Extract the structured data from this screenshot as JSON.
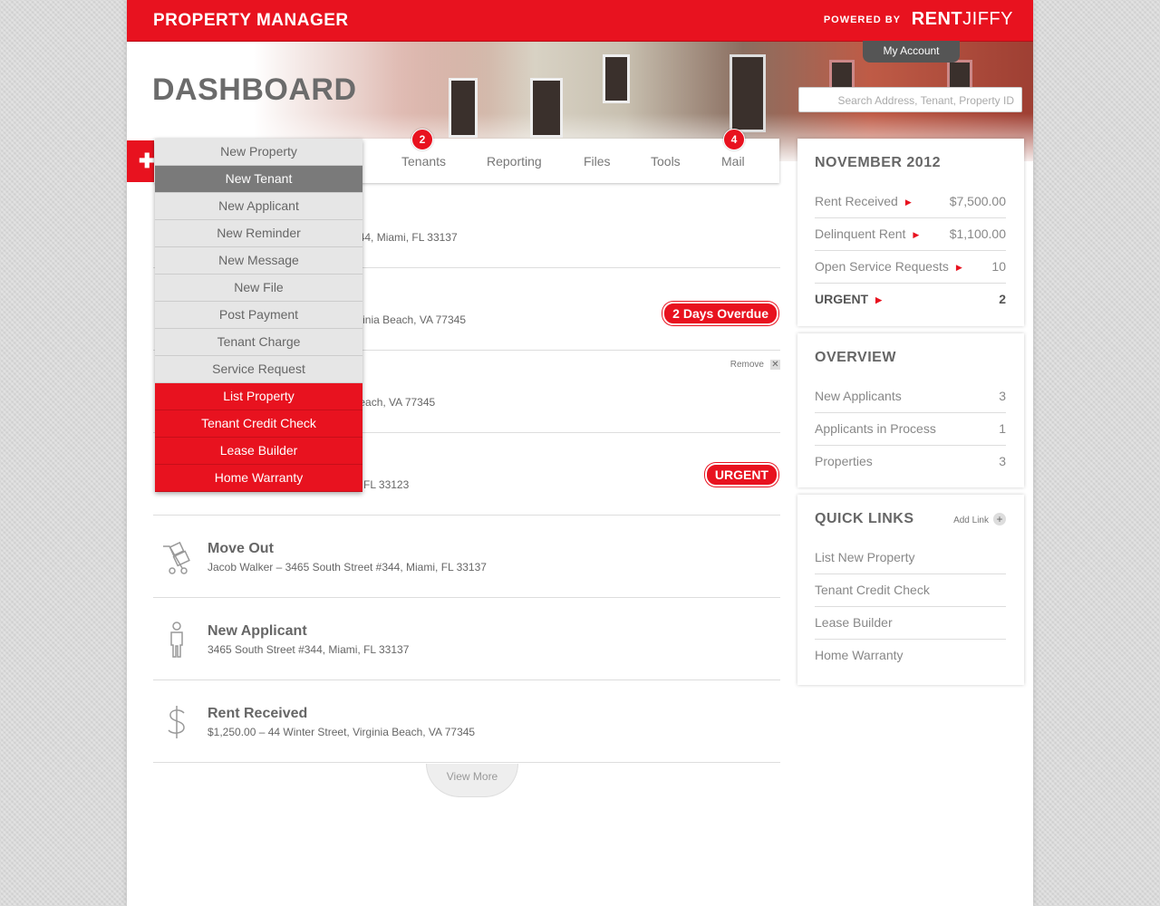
{
  "header": {
    "app_title": "PROPERTY MANAGER",
    "powered_by": "POWERED BY",
    "brand_bold": "RENT",
    "brand_light": "JIFFY",
    "my_account": "My Account",
    "search_placeholder": "Search Address, Tenant, Property ID",
    "page_title": "DASHBOARD"
  },
  "tabs": [
    {
      "label": "Tenants",
      "badge": "2"
    },
    {
      "label": "Reporting"
    },
    {
      "label": "Files"
    },
    {
      "label": "Tools"
    },
    {
      "label": "Mail",
      "badge": "4"
    }
  ],
  "new_menu": {
    "items": [
      "New Property",
      "New Tenant",
      "New Applicant",
      "New Reminder",
      "New Message",
      "New File",
      "Post Payment",
      "Tenant Charge",
      "Service Request"
    ],
    "active": "New Tenant",
    "featured": [
      "List Property",
      "Tenant Credit Check",
      "Lease Builder",
      "Home Warranty"
    ]
  },
  "feed": [
    {
      "subtitle_partial": "et #344, Miami, FL 33137"
    },
    {
      "subtitle_partial": "t, Virginia Beach, VA 77345",
      "pill": "2 Days Overdue"
    },
    {
      "subtitle_partial": "nia Beach, VA 77345",
      "remove": "Remove"
    },
    {
      "subtitle_partial": "akes, FL 33123",
      "pill": "URGENT"
    },
    {
      "title": "Move Out",
      "subtitle": "Jacob Walker – 3465 South Street #344, Miami, FL 33137",
      "icon": "hand-truck-icon"
    },
    {
      "title": "New Applicant",
      "subtitle": "3465 South Street #344, Miami, FL 33137",
      "icon": "person-icon"
    },
    {
      "title": "Rent Received",
      "subtitle": "$1,250.00 – 44 Winter Street, Virginia Beach, VA 77345",
      "icon": "dollar-icon"
    }
  ],
  "view_more": "View More",
  "month_card": {
    "title": "NOVEMBER 2012",
    "rows": [
      {
        "label": "Rent Received",
        "value": "$7,500.00"
      },
      {
        "label": "Delinquent Rent",
        "value": "$1,100.00"
      },
      {
        "label": "Open Service Requests",
        "value": "10"
      },
      {
        "label": "URGENT",
        "value": "2"
      }
    ]
  },
  "overview_card": {
    "title": "OVERVIEW",
    "rows": [
      {
        "label": "New Applicants",
        "value": "3"
      },
      {
        "label": "Applicants in Process",
        "value": "1"
      },
      {
        "label": "Properties",
        "value": "3"
      }
    ]
  },
  "quick_links": {
    "title": "QUICK LINKS",
    "add_label": "Add Link",
    "links": [
      "List New Property",
      "Tenant Credit Check",
      "Lease Builder",
      "Home Warranty"
    ]
  },
  "colors": {
    "accent": "#e8121f",
    "text": "#666666"
  }
}
